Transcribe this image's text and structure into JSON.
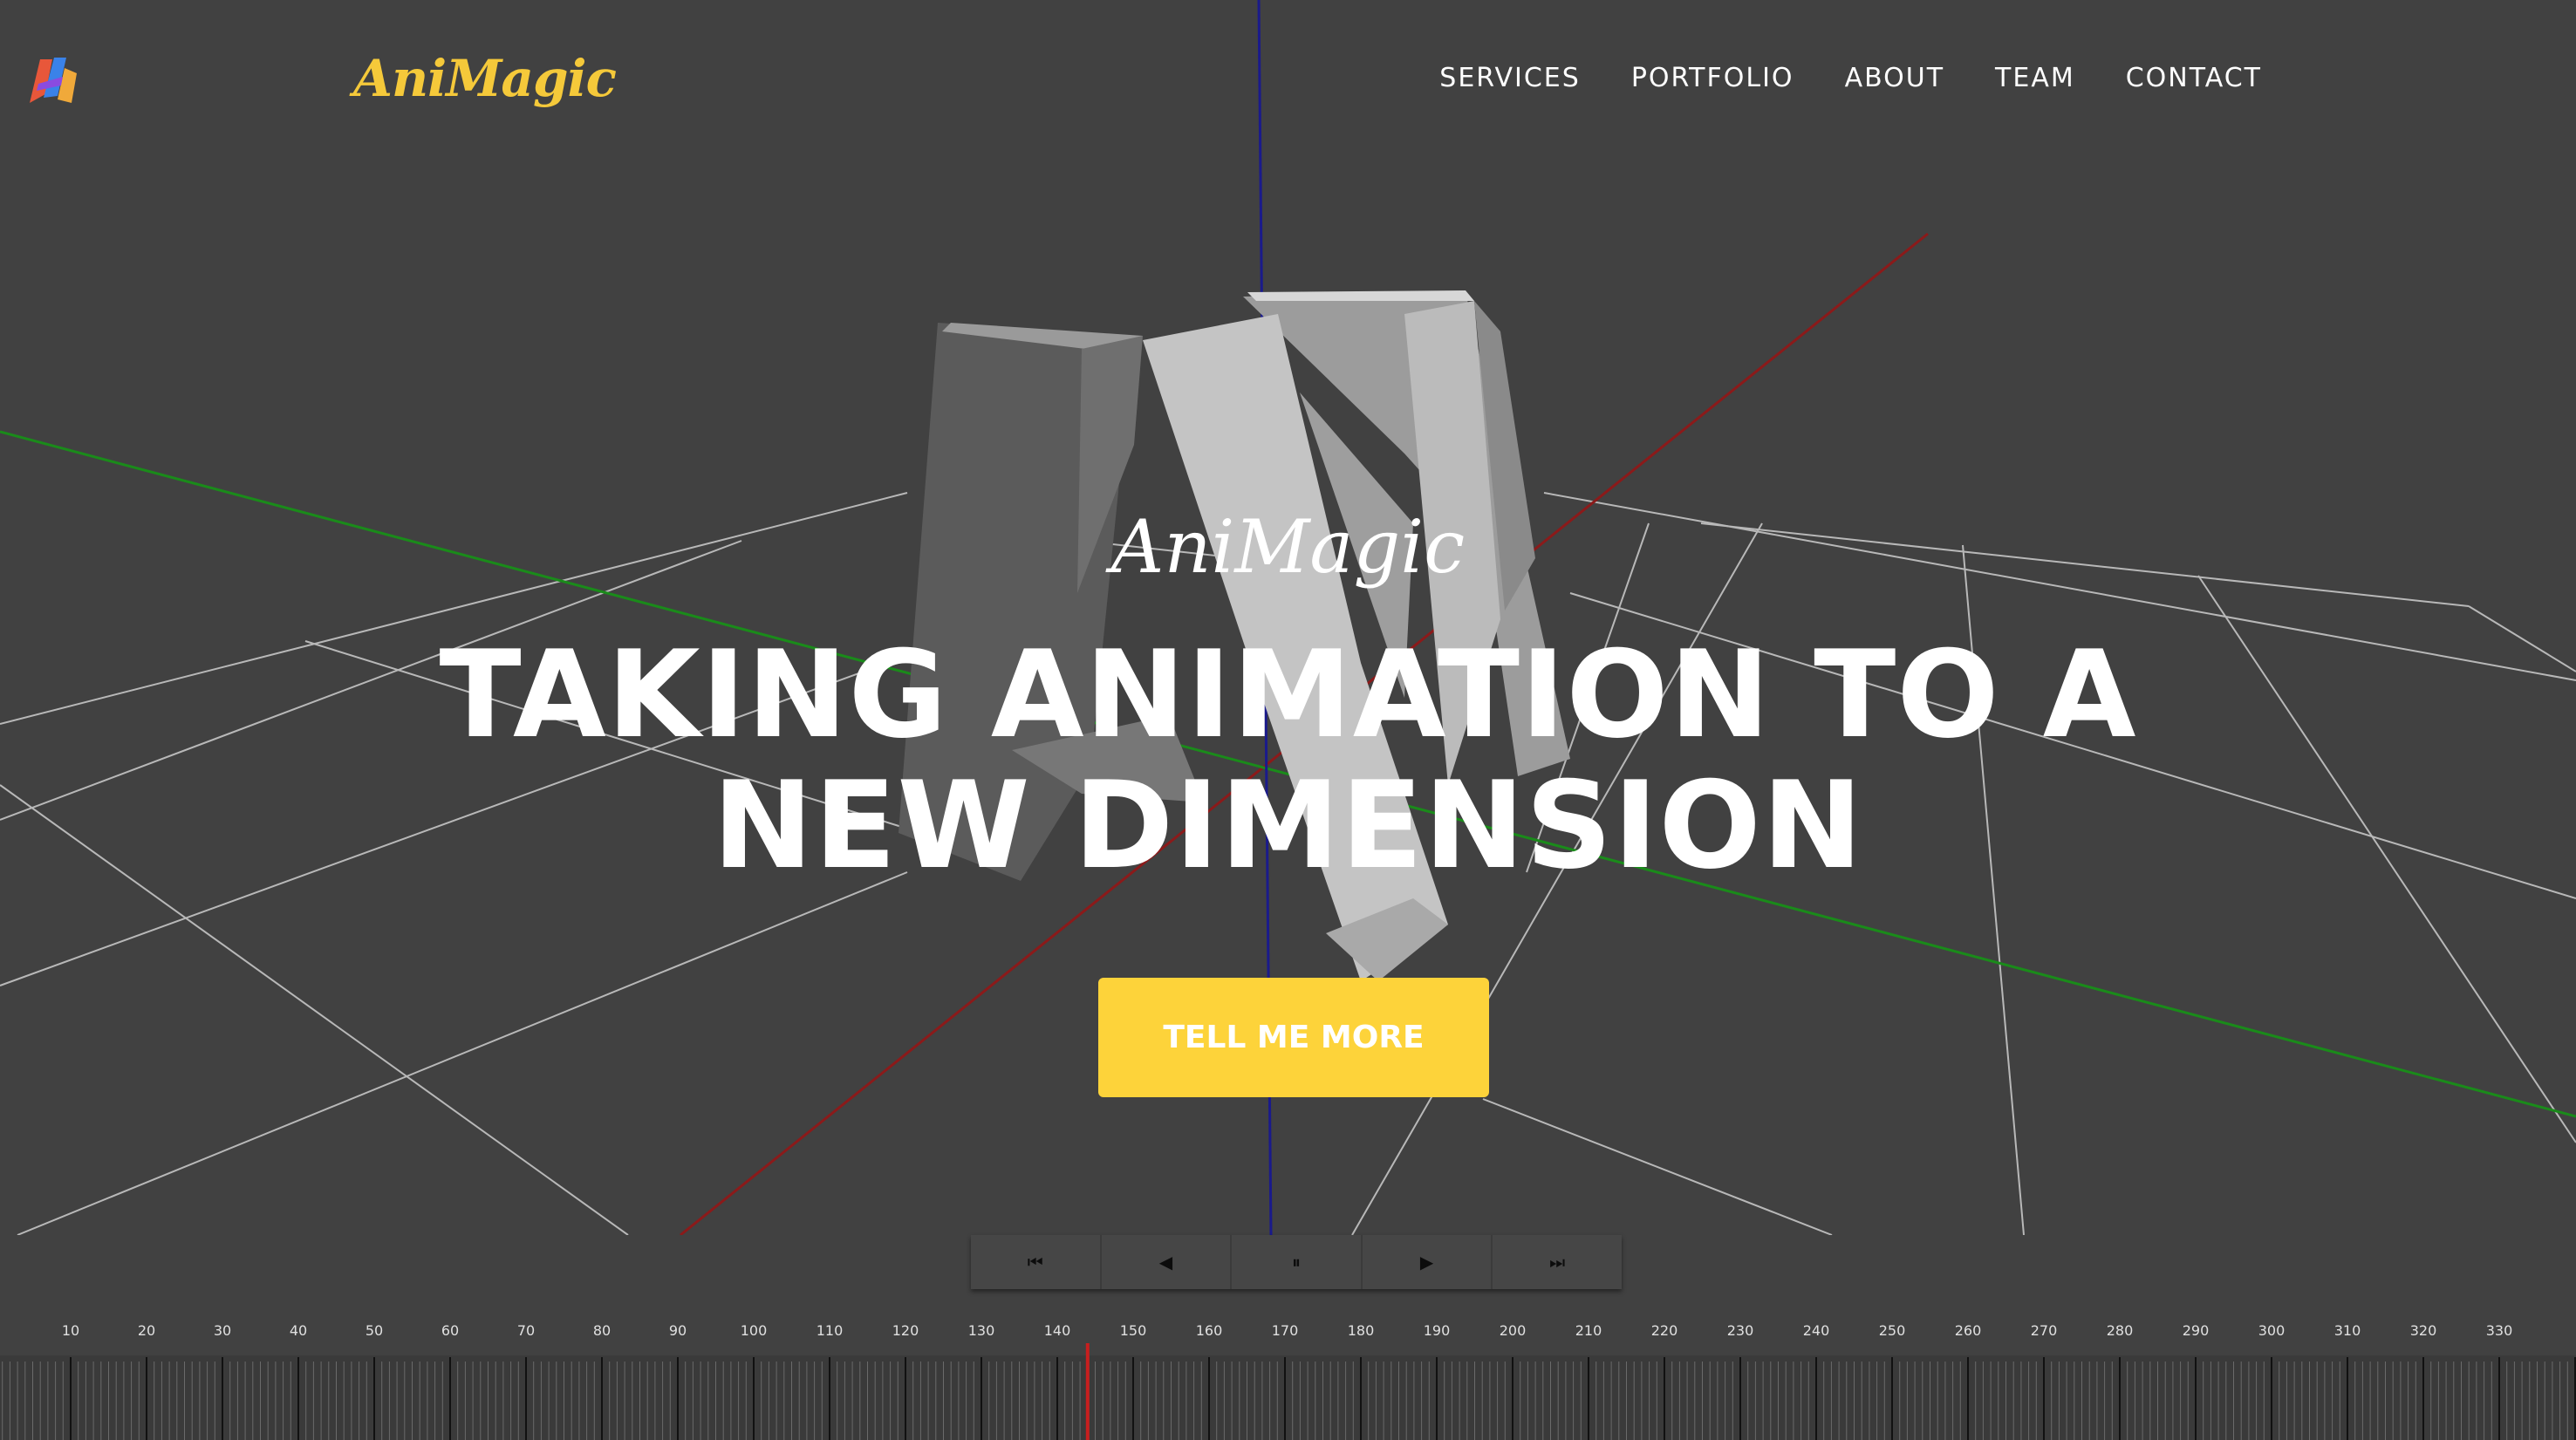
{
  "brand": {
    "name": "AniMagic",
    "logo_icon": "animagic-logo-icon"
  },
  "nav": {
    "items": [
      {
        "label": "SERVICES"
      },
      {
        "label": "PORTFOLIO"
      },
      {
        "label": "ABOUT"
      },
      {
        "label": "TEAM"
      },
      {
        "label": "CONTACT"
      }
    ]
  },
  "hero": {
    "subheading": "AniMagic",
    "heading_line1": "TAKING ANIMATION TO A",
    "heading_line2": "NEW DIMENSION",
    "cta_label": "TELL ME MORE"
  },
  "player": {
    "controls": [
      {
        "icon": "skip-to-start-icon",
        "glyph": "⏮"
      },
      {
        "icon": "step-back-icon",
        "glyph": "◀"
      },
      {
        "icon": "pause-icon",
        "glyph": "⏸"
      },
      {
        "icon": "play-icon",
        "glyph": "▶"
      },
      {
        "icon": "skip-to-end-icon",
        "glyph": "⏭"
      }
    ],
    "ruler_labels": [
      "10",
      "20",
      "30",
      "40",
      "50",
      "60",
      "70",
      "80",
      "90",
      "100",
      "110",
      "120",
      "130",
      "140",
      "150",
      "160",
      "170",
      "180",
      "190",
      "200",
      "210",
      "220",
      "230",
      "240",
      "250",
      "260",
      "270",
      "280",
      "290",
      "300",
      "310",
      "320",
      "330"
    ],
    "current_frame": 144
  },
  "colors": {
    "background": "#414141",
    "accent": "#fdd33a",
    "brand": "#f5c93a",
    "playhead": "#c81e1e",
    "axis_x": "#8b1a1a",
    "axis_y": "#1a1a8b",
    "axis_z": "#1a8b1a"
  }
}
